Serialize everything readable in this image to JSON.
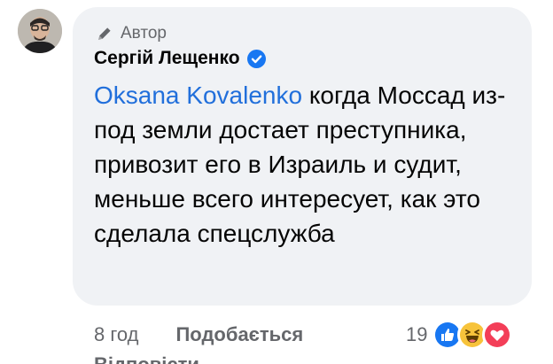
{
  "comment": {
    "author_badge": "Автор",
    "author_name": "Сергій Лещенко",
    "mention": "Oksana Kovalenko",
    "text": " когда Моссад из-под земли достает преступника, привозит его в Израиль и судит, меньше всего интересует, как это сделала спецслужба"
  },
  "footer": {
    "time": "8 год",
    "like_label": "Подобається",
    "reply_label": "Відповісти",
    "reaction_count": "19"
  },
  "reactions": [
    "like-icon",
    "haha-icon",
    "love-icon"
  ],
  "colors": {
    "bubble": "#f0f2f5",
    "mention": "#216fdb",
    "secondary_text": "#65676b",
    "verified": "#1877f2"
  }
}
